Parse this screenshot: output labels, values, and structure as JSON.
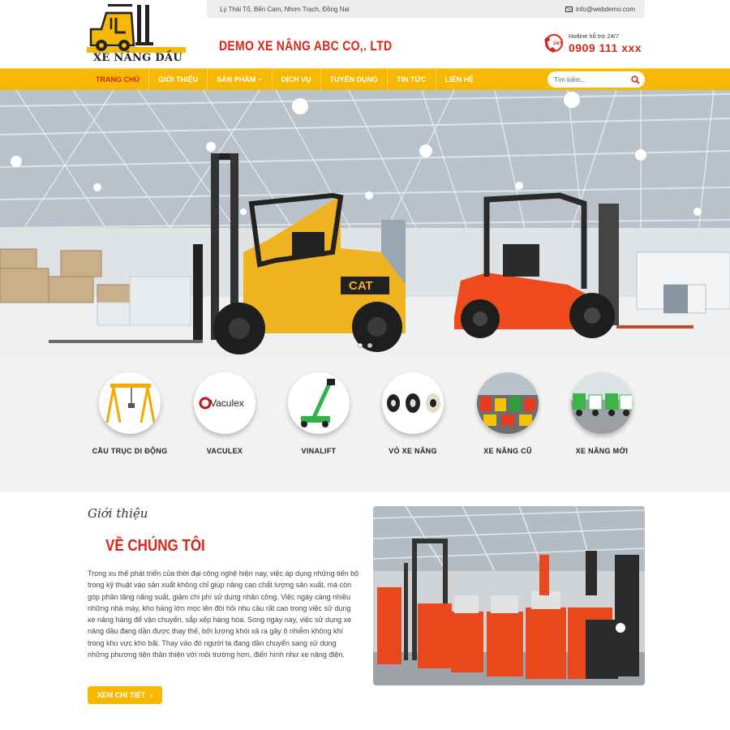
{
  "topbar": {
    "address": "Lý Thái Tổ, Bến Cam, Nhơn Trạch, Đồng Nai",
    "email": "info@webdemo.com"
  },
  "logo": {
    "text": "XE NÂNG DẦU"
  },
  "company": {
    "name": "DEMO XE NÂNG ABC CO,. LTD"
  },
  "hotline": {
    "label": "Hotline hỗ trợ 24/7",
    "number": "0909 111 xxx",
    "badge": "24/7"
  },
  "nav": {
    "items": [
      {
        "label": "Trang chủ"
      },
      {
        "label": "Giới thiệu"
      },
      {
        "label": "Sản phẩm"
      },
      {
        "label": "Dịch vụ"
      },
      {
        "label": "Tuyển dụng"
      },
      {
        "label": "Tin tức"
      },
      {
        "label": "Liên hệ"
      }
    ],
    "search_placeholder": "Tìm kiếm..."
  },
  "hero": {
    "cat_logo": "CAT",
    "slide_count": 2,
    "active_slide": 1
  },
  "categories": [
    {
      "label": "Cầu trục di động",
      "icon": "gantry-crane"
    },
    {
      "label": "Vaculex",
      "icon": "vaculex-logo",
      "logo_text": "Vaculex"
    },
    {
      "label": "Vinalift",
      "icon": "green-lift"
    },
    {
      "label": "Vỏ xe nâng",
      "icon": "tires"
    },
    {
      "label": "Xe nâng cũ",
      "icon": "used-forklifts"
    },
    {
      "label": "Xe nâng mới",
      "icon": "new-forklifts"
    }
  ],
  "about": {
    "script_title": "Giới thiệu",
    "title": "VỀ CHÚNG TÔI",
    "body": "Trong xu thế phát triển của thời đại công nghệ hiện nay, việc áp dụng những tiến bộ trong kỹ thuật vào sản xuất không chỉ giúp nâng cao chất lượng sản xuất, mà còn góp phần tăng năng suất, giảm chi phí sử dụng nhân công. Việc ngày càng nhiều những nhà máy, kho hàng lớn mọc lên đòi hỏi nhu cầu rất cao trong việc sử dụng xe nâng hàng để vận chuyển, sắp xếp hàng hóa. Song ngày nay, việc sử dụng xe nâng dầu đang dần được thay thế, bởi lượng khói xả ra gây ô nhiễm không khí trong khu vực kho bãi. Thay vào đó người ta đang dần chuyển sang sử dụng những phương tiện thân thiện với môi trường hơn, điển hình như xe nâng điện.",
    "button_label": "XEM CHI TIẾT"
  },
  "colors": {
    "accent": "#f6b800",
    "brand_red": "#d7261a",
    "forklift_orange": "#ee4a1c"
  }
}
